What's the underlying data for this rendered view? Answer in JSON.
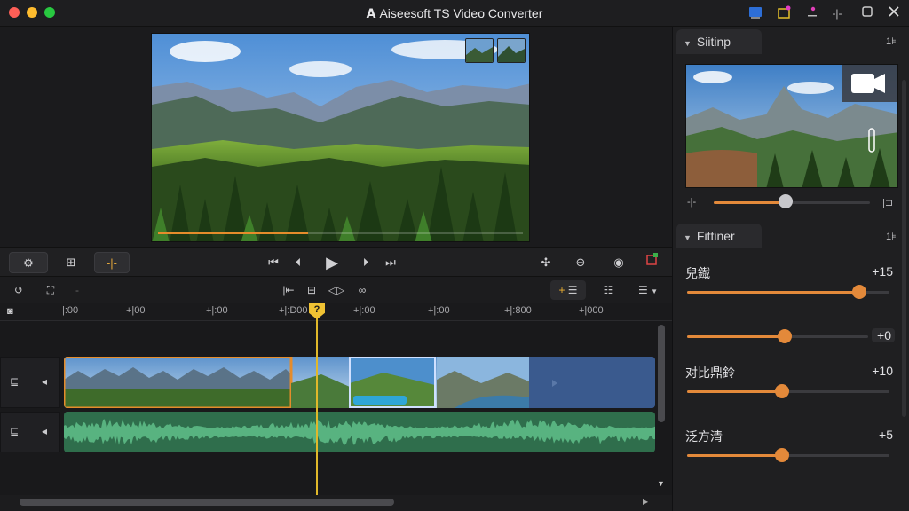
{
  "app": {
    "title": "Aiseesoft TS Video Converter",
    "logo_glyph": "A"
  },
  "titlebar_icons": [
    "window-icon",
    "sticky-icon",
    "dot-icon",
    "split-icon",
    "restore-icon",
    "close-icon"
  ],
  "player": {
    "progress": 0.41
  },
  "transport": {
    "settings_icon": "gear-icon",
    "crop_label": "⊞",
    "split_label": "-|-"
  },
  "timeline": {
    "ruler": [
      ":00",
      "+|00",
      "+|00",
      "+|:00",
      "+|:00",
      "+|00",
      "+|00",
      "+|000"
    ],
    "ruler_extra": [
      "|:00",
      "+|00",
      "+|:00",
      "+|:D00",
      "+|:00",
      "+|:00",
      "+|:800",
      "+|000"
    ],
    "playhead_label": "?"
  },
  "panel": {
    "section1_title": "Siitinp",
    "section1_right": "1⊧",
    "section2_title": "Fittiner",
    "section2_right": "1⊧",
    "filters": [
      {
        "label": "兒鐡",
        "value": "+15",
        "level": 0.85
      },
      {
        "label": "",
        "value": "+0",
        "level": 0.54
      },
      {
        "label": "对比鼎鈴",
        "value": "+10",
        "level": 0.47
      },
      {
        "label": "泛方清",
        "value": "+5",
        "level": 0.47
      }
    ],
    "preview_level": 0.46
  },
  "colors": {
    "accent": "#e58c2b",
    "playhead": "#f0c233",
    "clip_video": "#3a5a8e",
    "clip_audio": "#2f6e4c"
  }
}
